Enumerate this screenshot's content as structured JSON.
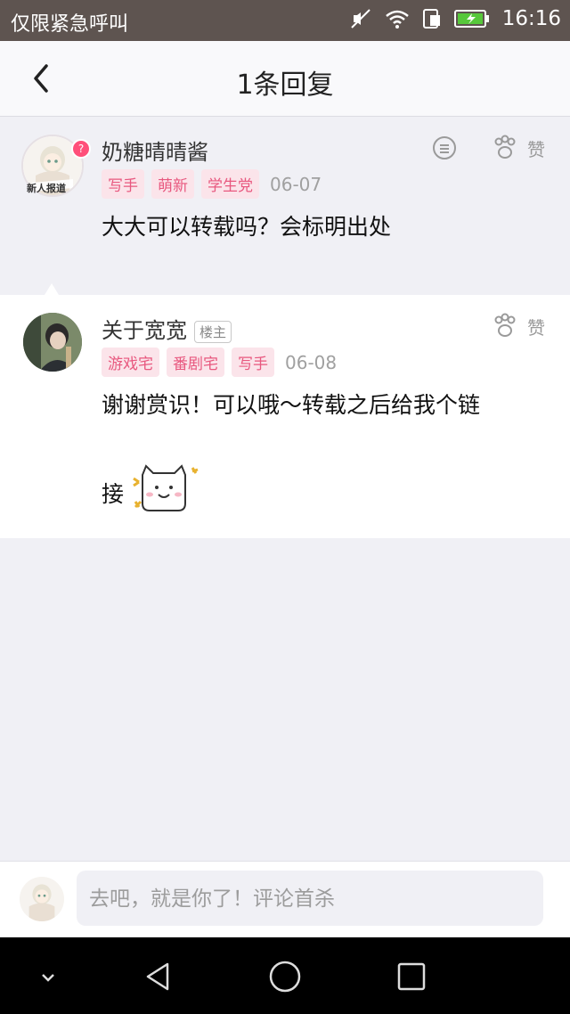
{
  "status_bar": {
    "carrier": "仅限紧急呼叫",
    "time": "16:16"
  },
  "header": {
    "title": "1条回复"
  },
  "comments": [
    {
      "username": "奶糖晴晴酱",
      "badge": "",
      "tags": [
        "写手",
        "萌新",
        "学生党"
      ],
      "date": "06-07",
      "text": "大大可以转载吗？会标明出处",
      "like_label": "赞",
      "avatar_text": "新人报道"
    },
    {
      "username": "关于宽宽",
      "badge": "楼主",
      "tags": [
        "游戏宅",
        "番剧宅",
        "写手"
      ],
      "date": "06-08",
      "text_line1": "谢谢赏识！可以哦～转载之后给我个链",
      "text_line2": "接",
      "like_label": "赞"
    }
  ],
  "input": {
    "placeholder": "去吧，就是你了！评论首杀"
  },
  "colors": {
    "tag_bg": "#fbe4ea",
    "tag_text": "#e8587f",
    "status_bar": "#5e5450"
  }
}
